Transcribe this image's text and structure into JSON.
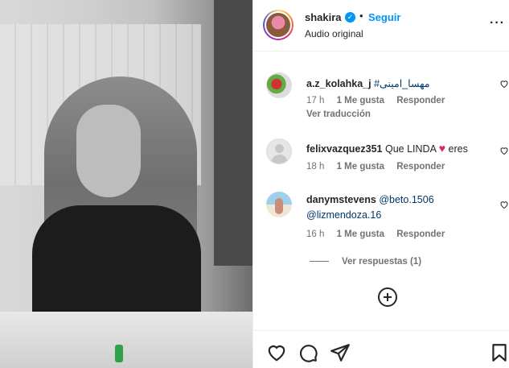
{
  "header": {
    "username": "shakira",
    "separator": "•",
    "follow_label": "Seguir",
    "subtitle": "Audio original",
    "more_label": "···"
  },
  "comments": [
    {
      "username": "a.z_kolahka_j",
      "text": "#مهسا_امینی",
      "time": "17 h",
      "likes": "1 Me gusta",
      "reply": "Responder",
      "translate": "Ver traducción"
    },
    {
      "username": "felixvazquez351",
      "text_before": "Que LINDA",
      "emoji": "♥",
      "text_after": "eres",
      "time": "18 h",
      "likes": "1 Me gusta",
      "reply": "Responder"
    },
    {
      "username": "danymstevens",
      "mention1": "@beto.1506",
      "mention2": "@lizmendoza.16",
      "time": "16 h",
      "likes": "1 Me gusta",
      "reply": "Responder"
    }
  ],
  "view_replies": "Ver respuestas (1)",
  "colors": {
    "accent": "#0095f6",
    "text": "#262626",
    "muted": "#737373",
    "mention": "#00376b",
    "heart": "#e0245e"
  },
  "icons": [
    "heart-icon",
    "comment-icon",
    "share-icon",
    "bookmark-icon",
    "add-comment-icon",
    "verified-icon"
  ]
}
